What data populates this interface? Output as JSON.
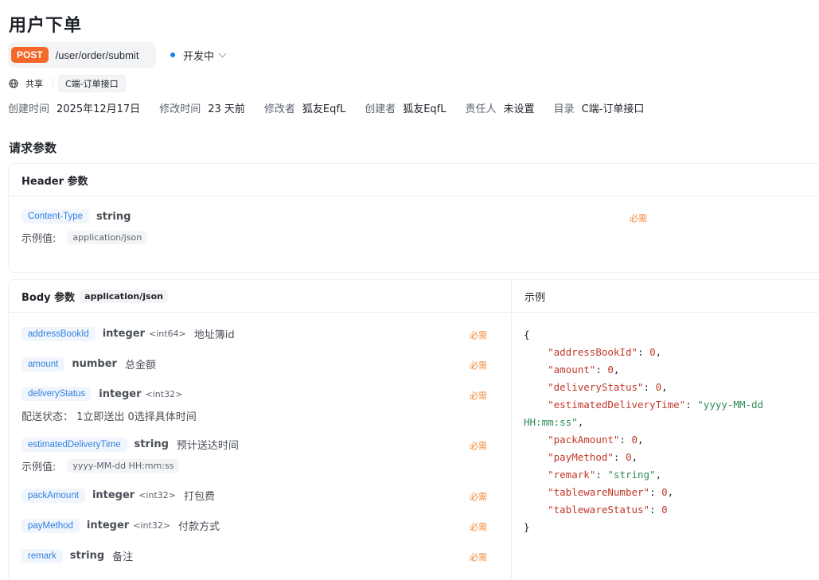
{
  "page": {
    "title": "用户下单",
    "endpoint": {
      "method": "POST",
      "path": "/user/order/submit"
    },
    "status": {
      "label": "开发中",
      "color": "#1e7ff0"
    },
    "share": {
      "icon": "globe-icon",
      "label": "共享",
      "category": "C端-订单接口"
    },
    "meta": [
      {
        "label": "创建时间",
        "value": "2025年12月17日"
      },
      {
        "label": "修改时间",
        "value": "23 天前"
      },
      {
        "label": "修改者",
        "value": "狐友EqfL"
      },
      {
        "label": "创建者",
        "value": "狐友EqfL"
      },
      {
        "label": "责任人",
        "value": "未设置"
      },
      {
        "label": "目录",
        "value": "C端-订单接口"
      }
    ]
  },
  "request": {
    "section_title": "请求参数",
    "header": {
      "title": "Header 参数",
      "params": [
        {
          "name": "Content-Type",
          "type": "string",
          "required": "必需",
          "example_label": "示例值:",
          "example": "application/json"
        }
      ]
    },
    "body": {
      "title": "Body 参数",
      "content_type": "application/json",
      "required_label": "必需",
      "params": [
        {
          "name": "addressBookId",
          "type": "integer",
          "format": "<int64>",
          "desc": "地址簿id"
        },
        {
          "name": "amount",
          "type": "number",
          "format": "",
          "desc": "总金额"
        },
        {
          "name": "deliveryStatus",
          "type": "integer",
          "format": "<int32>",
          "desc": "",
          "note": "配送状态： 1立即送出 0选择具体时间"
        },
        {
          "name": "estimatedDeliveryTime",
          "type": "string",
          "format": "",
          "desc": "预计送达时间",
          "example_label": "示例值:",
          "example": "yyyy-MM-dd HH:mm:ss"
        },
        {
          "name": "packAmount",
          "type": "integer",
          "format": "<int32>",
          "desc": "打包费"
        },
        {
          "name": "payMethod",
          "type": "integer",
          "format": "<int32>",
          "desc": "付款方式"
        },
        {
          "name": "remark",
          "type": "string",
          "format": "",
          "desc": "备注"
        }
      ]
    },
    "example": {
      "title": "示例",
      "fields": [
        {
          "key": "\"addressBookId\"",
          "value": "0",
          "kind": "num"
        },
        {
          "key": "\"amount\"",
          "value": "0",
          "kind": "num"
        },
        {
          "key": "\"deliveryStatus\"",
          "value": "0",
          "kind": "num"
        },
        {
          "key": "\"estimatedDeliveryTime\"",
          "value": "\"yyyy-MM-dd HH:mm:ss\"",
          "kind": "str"
        },
        {
          "key": "\"packAmount\"",
          "value": "0",
          "kind": "num"
        },
        {
          "key": "\"payMethod\"",
          "value": "0",
          "kind": "num"
        },
        {
          "key": "\"remark\"",
          "value": "\"string\"",
          "kind": "str"
        },
        {
          "key": "\"tablewareNumber\"",
          "value": "0",
          "kind": "num"
        },
        {
          "key": "\"tablewareStatus\"",
          "value": "0",
          "kind": "num"
        }
      ]
    }
  }
}
